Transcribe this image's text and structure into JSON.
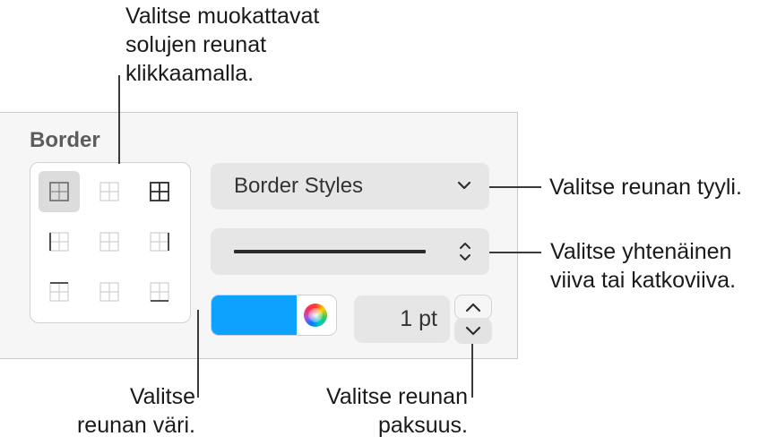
{
  "callouts": {
    "cell_edges": [
      "Valitse muokattavat",
      "solujen reunat",
      "klikkaamalla."
    ],
    "border_style": "Valitse reunan tyyli.",
    "line_type": [
      "Valitse yhtenäinen",
      "viiva tai katkoviiva."
    ],
    "border_color": [
      "Valitse",
      "reunan väri."
    ],
    "border_thickness": [
      "Valitse reunan",
      "paksuus."
    ]
  },
  "panel": {
    "title": "Border",
    "border_styles_label": "Border Styles",
    "thickness_value": "1 pt",
    "color_swatch": "#0ea2ff"
  },
  "icons": {
    "grid": [
      "all-borders-icon",
      "inside-borders-icon",
      "outside-and-inside-borders-icon",
      "left-border-icon",
      "inside-vertical-border-icon",
      "right-border-icon",
      "top-border-icon",
      "inside-horizontal-border-icon",
      "bottom-border-icon"
    ],
    "dropdown": "chevron-down-icon",
    "line_popup": "up-down-chevron-icon",
    "color": "color-wheel-icon"
  }
}
